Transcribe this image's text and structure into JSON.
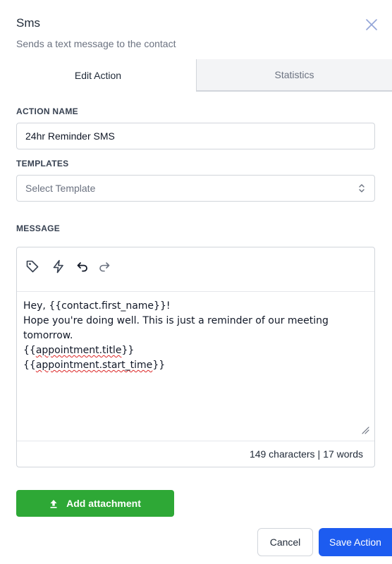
{
  "header": {
    "title": "Sms",
    "subtitle": "Sends a text message to the contact",
    "close_icon": "close-icon"
  },
  "tabs": [
    {
      "label": "Edit Action",
      "active": true
    },
    {
      "label": "Statistics",
      "active": false
    }
  ],
  "action_name": {
    "label": "ACTION NAME",
    "value": "24hr Reminder SMS"
  },
  "templates": {
    "label": "TEMPLATES",
    "placeholder": "Select Template"
  },
  "message": {
    "label": "MESSAGE",
    "toolbar_icons": [
      "tag-icon",
      "bolt-icon",
      "undo-icon",
      "redo-icon"
    ],
    "line1": "Hey, {{contact.first_name}}!",
    "line2": "Hope you're doing well. This is just a reminder of our meeting tomorrow.",
    "line3_open": "{{",
    "line3_word": "appointment.title",
    "line3_close": "}}",
    "line4_open": "{{",
    "line4_word": "appointment.start_time",
    "line4_close": "}}",
    "characters": "149 characters",
    "separator": "|",
    "words": "17 words"
  },
  "buttons": {
    "attachment": "Add attachment",
    "cancel": "Cancel",
    "save": "Save Action"
  },
  "colors": {
    "primary": "#1d5cf0",
    "success": "#2ea836",
    "border": "#d1d5db",
    "muted": "#6b7280"
  }
}
